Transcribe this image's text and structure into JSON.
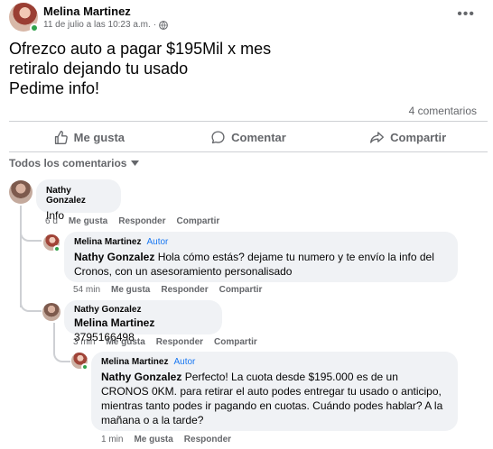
{
  "post": {
    "author": "Melina Martinez",
    "timestamp": "11 de julio a las 10:23 a.m.",
    "audience_separator": "·",
    "more_label": "•••",
    "text_lines": [
      "Ofrezco auto a pagar $195Mil x mes",
      "retiralo dejando tu usado",
      "Pedime info!"
    ],
    "comments_count": "4 comentarios"
  },
  "actions": {
    "like": "Me gusta",
    "comment": "Comentar",
    "share": "Compartir"
  },
  "sort_label": "Todos los comentarios",
  "comments": [
    {
      "name": "Nathy Gonzalez",
      "text": "Info",
      "time": "6 d",
      "like": "Me gusta",
      "reply": "Responder",
      "share": "Compartir"
    },
    {
      "name": "Melina Martinez",
      "badge": "Autor",
      "mention": "Nathy Gonzalez",
      "text_after_mention": " Hola cómo estás? dejame tu numero y te envío la info del Cronos, con un asesoramiento personalisado",
      "time": "54 min",
      "like": "Me gusta",
      "reply": "Responder",
      "share": "Compartir"
    },
    {
      "name": "Nathy Gonzalez",
      "mention": "Melina Martinez",
      "text_after_mention": " 3795166498",
      "time": "3 min",
      "like": "Me gusta",
      "reply": "Responder",
      "share": "Compartir"
    },
    {
      "name": "Melina Martinez",
      "badge": "Autor",
      "mention": "Nathy Gonzalez",
      "text_after_mention": " Perfecto! La cuota desde $195.000 es de un CRONOS 0KM. para retirar el auto podes entregar tu usado o anticipo, mientras tanto podes ir pagando en cuotas. Cuándo podes hablar? A la mañana o a la tarde?",
      "time": "1 min",
      "like": "Me gusta",
      "reply": "Responder"
    }
  ],
  "colors": {
    "accent": "#1877f2",
    "secondary_text": "#65676b",
    "bubble": "#f0f2f5",
    "online": "#31a24c"
  }
}
